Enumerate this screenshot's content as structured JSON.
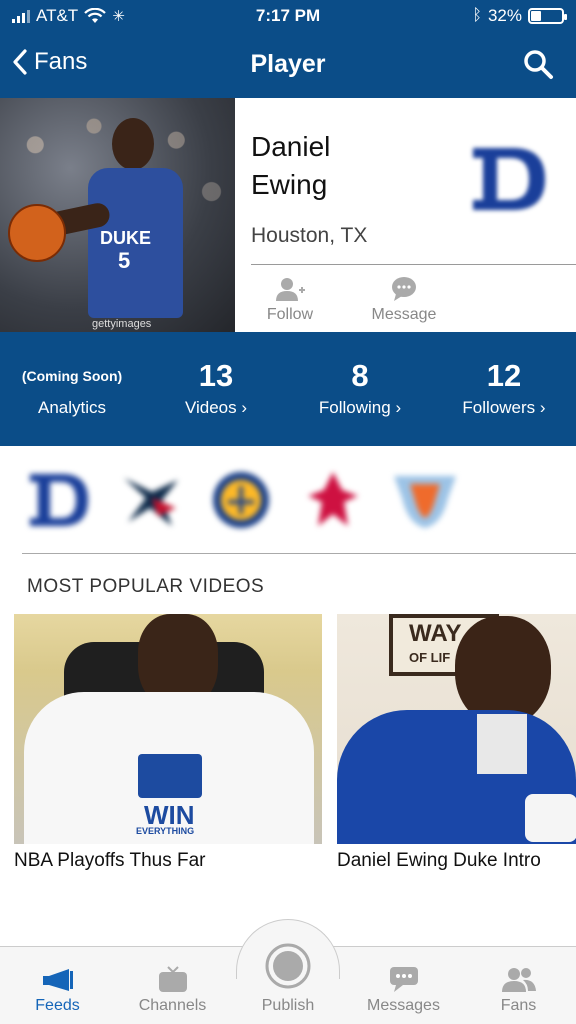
{
  "status": {
    "carrier": "AT&T",
    "time": "7:17 PM",
    "battery_pct": "32%",
    "battery_level": 0.32
  },
  "nav": {
    "back_label": "Fans",
    "title": "Player"
  },
  "player": {
    "name_line1": "Daniel",
    "name_line2": "Ewing",
    "location": "Houston, TX",
    "photo_jersey_text": "DUKE",
    "photo_jersey_number": "5",
    "photo_credit": "gettyimages",
    "follow_label": "Follow",
    "message_label": "Message"
  },
  "stats": [
    {
      "value": "(Coming Soon)",
      "label": "Analytics"
    },
    {
      "value": "13",
      "label": "Videos"
    },
    {
      "value": "8",
      "label": "Following"
    },
    {
      "value": "12",
      "label": "Followers"
    }
  ],
  "teams": [
    "duke-logo",
    "texans-logo",
    "warriors-logo",
    "rockets-logo",
    "thunder-logo"
  ],
  "section_title": "MOST POPULAR VIDEOS",
  "videos": [
    {
      "title": "NBA Playoffs Thus Far",
      "shirt_text": "WIN",
      "shirt_subtext": "EVERYTHING"
    },
    {
      "title": "Daniel Ewing Duke Intro",
      "sign_text_line1": "WAY",
      "sign_text_line2": "OF LIF"
    }
  ],
  "tabs": [
    {
      "label": "Feeds",
      "icon": "megaphone-icon",
      "active": true
    },
    {
      "label": "Channels",
      "icon": "tv-icon",
      "active": false
    },
    {
      "label": "Publish",
      "icon": "record-icon",
      "active": false
    },
    {
      "label": "Messages",
      "icon": "chat-icon",
      "active": false
    },
    {
      "label": "Fans",
      "icon": "people-icon",
      "active": false
    }
  ],
  "colors": {
    "primary": "#0b4d88",
    "active_tab": "#1565b8",
    "duke_blue": "#1a3f9a"
  }
}
